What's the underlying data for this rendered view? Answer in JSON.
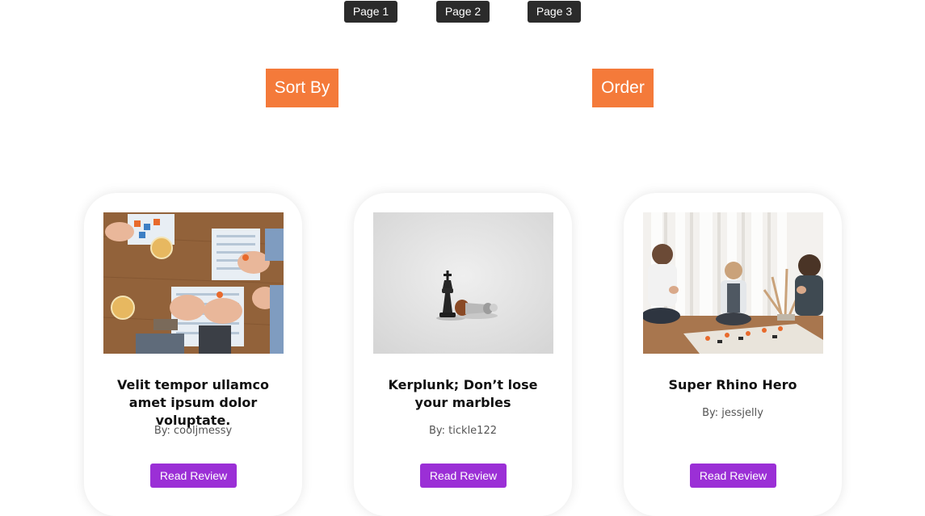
{
  "pagination": {
    "pages": [
      "Page 1",
      "Page 2",
      "Page 3"
    ]
  },
  "controls": {
    "sort_by_label": "Sort By",
    "order_label": "Order"
  },
  "colors": {
    "page_button_bg": "#2b2b2b",
    "sort_button_bg": "#f47a3a",
    "read_button_bg": "#9b2fd6"
  },
  "reviews": [
    {
      "title": "Velit tempor ullamco amet ipsum dolor voluptate.",
      "author": "By: cooljmessy",
      "button_label": "Read Review",
      "image": "board-game-table-photo"
    },
    {
      "title": "Kerplunk; Don’t lose your marbles",
      "author": "By: tickle122",
      "button_label": "Read Review",
      "image": "chess-pieces-photo"
    },
    {
      "title": "Super Rhino Hero",
      "author": "By: jessjelly",
      "button_label": "Read Review",
      "image": "kids-playing-game-photo"
    }
  ]
}
